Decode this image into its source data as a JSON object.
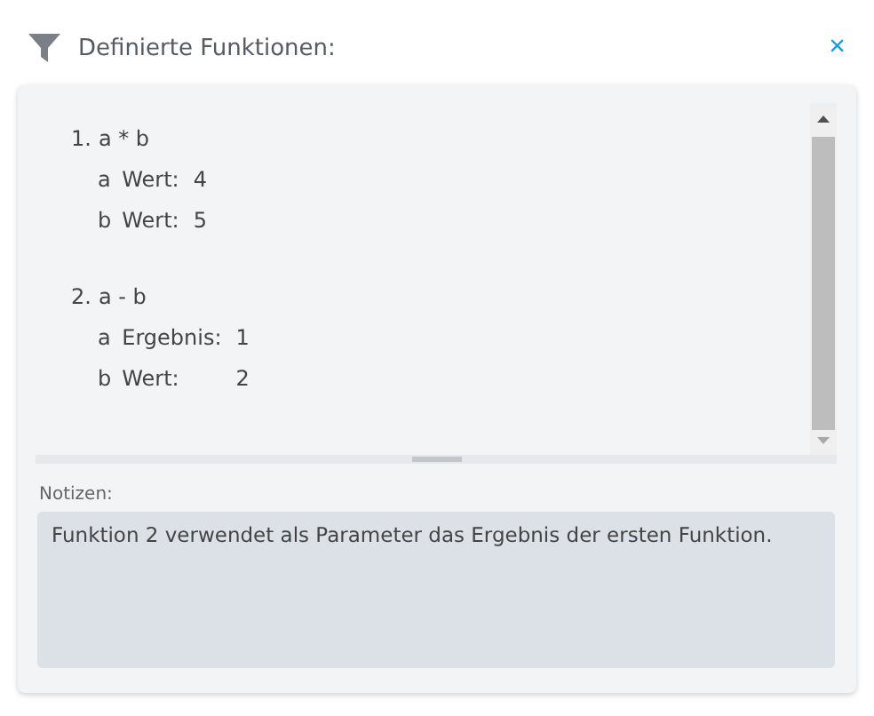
{
  "header": {
    "title": "Definierte Funktionen:",
    "close": "×"
  },
  "functions": [
    {
      "number": "1.",
      "expression": "a * b",
      "params": [
        {
          "letter": "a",
          "label": "Wert:",
          "value": "4"
        },
        {
          "letter": "b",
          "label": "Wert:",
          "value": "5"
        }
      ]
    },
    {
      "number": "2.",
      "expression": "a - b",
      "params": [
        {
          "letter": "a",
          "label": "Ergebnis:",
          "value": "1"
        },
        {
          "letter": "b",
          "label": "Wert:",
          "value": "2"
        }
      ]
    }
  ],
  "notes": {
    "label": "Notizen:",
    "value": "Funktion 2 verwendet als Parameter das Ergebnis der ersten Funktion."
  }
}
